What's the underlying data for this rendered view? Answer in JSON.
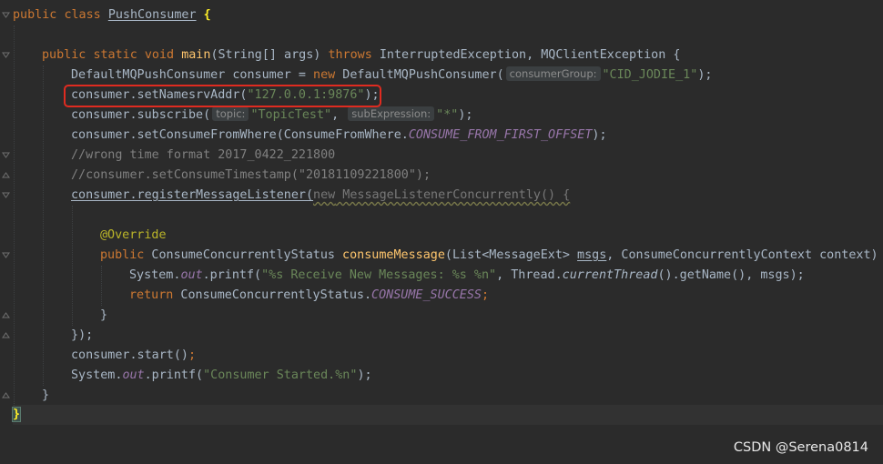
{
  "editor": {
    "class_decl": {
      "kw1": "public",
      "kw2": "class",
      "name": "PushConsumer",
      "brace": "{"
    },
    "main_decl": {
      "kw1": "public",
      "kw2": "static",
      "kw3": "void",
      "name": "main",
      "params": "(String[] args) ",
      "throws": "throws",
      "exceptions": " InterruptedException, MQClientException {"
    },
    "consumer_decl": {
      "start": "DefaultMQPushConsumer consumer = ",
      "new": "new",
      "type": " DefaultMQPushConsumer(",
      "hint": "consumerGroup:",
      "arg": "\"CID_JODIE_1\"",
      "end": ");"
    },
    "set_namesrv": {
      "call": "consumer.setNamesrvAddr(",
      "arg": "\"127.0.0.1:9876\"",
      "end": ");"
    },
    "subscribe": {
      "call": "consumer.subscribe(",
      "hint1": "topic:",
      "arg1": "\"TopicTest\"",
      "comma": ", ",
      "hint2": "subExpression:",
      "arg2": "\"*\"",
      "end": ");"
    },
    "consume_from": {
      "call": "consumer.setConsumeFromWhere(ConsumeFromWhere.",
      "const": "CONSUME_FROM_FIRST_OFFSET",
      "end": ");"
    },
    "comment1": "//wrong time format 2017_0422_221800",
    "comment2": "//consumer.setConsumeTimestamp(\"20181109221800\");",
    "register": {
      "call": "consumer.registerMessageListener(",
      "anon_new": "new",
      "anon_type": " MessageListenerConcurrently() {"
    },
    "override": "@Override",
    "consume_decl": {
      "kw": "public",
      "ret": " ConsumeConcurrentlyStatus ",
      "name": "consumeMessage",
      "params_a": "(List<MessageExt> ",
      "msgs": "msgs",
      "params_b": ", ConsumeConcurrentlyContext context) {"
    },
    "printf1": {
      "pre": "System.",
      "out": "out",
      "call": ".printf(",
      "fmt": "\"%s Receive New Messages: %s %n\"",
      "mid": ", Thread.",
      "cur": "currentThread",
      "end": "().getName(), msgs);"
    },
    "return_line": {
      "kw": "return",
      "cls": " ConsumeConcurrentlyStatus.",
      "const": "CONSUME_SUCCESS",
      "end": ";"
    },
    "close_inner": "}",
    "close_listener": {
      "brace": "}",
      "paren": ");"
    },
    "start_line": {
      "call": "consumer.start()",
      "end": ";"
    },
    "printf2": {
      "pre": "System.",
      "out": "out",
      "call": ".printf(",
      "fmt": "\"Consumer Started.%n\"",
      "end": ");"
    },
    "close_method": "}",
    "close_class": "}"
  },
  "watermark": "CSDN @Serena0814",
  "colors": {
    "background": "#2b2b2b",
    "keyword": "#cc7832",
    "string": "#6a8759",
    "highlight_box": "#e02b20"
  }
}
